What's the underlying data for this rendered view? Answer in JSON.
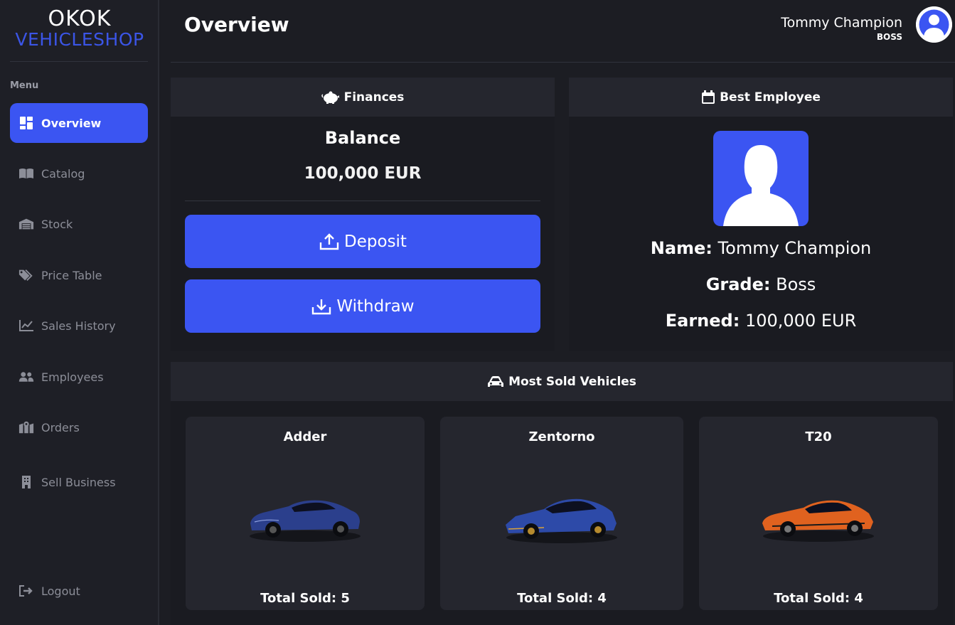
{
  "brand": {
    "top": "OKOK",
    "bottom": "VEHICLESHOP",
    "accent_color": "#3b55f2"
  },
  "sidebar": {
    "heading": "Menu",
    "items": [
      {
        "label": "Overview",
        "icon": "dashboard-icon",
        "active": true
      },
      {
        "label": "Catalog",
        "icon": "book-icon"
      },
      {
        "label": "Stock",
        "icon": "warehouse-icon"
      },
      {
        "label": "Price Table",
        "icon": "tags-icon"
      },
      {
        "label": "Sales History",
        "icon": "chart-line-icon"
      },
      {
        "label": "Employees",
        "icon": "users-icon"
      },
      {
        "label": "Orders",
        "icon": "map-icon"
      },
      {
        "label": "Sell Business",
        "icon": "building-icon"
      }
    ],
    "logout": {
      "label": "Logout",
      "icon": "logout-icon"
    }
  },
  "header": {
    "title": "Overview",
    "user_name": "Tommy Champion",
    "user_role": "BOSS"
  },
  "finances": {
    "heading": "Finances",
    "icon": "piggy-bank-icon",
    "balance_label": "Balance",
    "balance_value": "100,000 EUR",
    "deposit_label": "Deposit",
    "withdraw_label": "Withdraw"
  },
  "best_employee": {
    "heading": "Best Employee",
    "icon": "calendar-icon",
    "name_label": "Name:",
    "name_value": "Tommy Champion",
    "grade_label": "Grade:",
    "grade_value": "Boss",
    "earned_label": "Earned:",
    "earned_value": "100,000 EUR"
  },
  "most_sold": {
    "heading": "Most Sold Vehicles",
    "icon": "car-icon",
    "vehicles": [
      {
        "name": "Adder",
        "sold": "Total Sold: 5",
        "color": "#2b3f8c"
      },
      {
        "name": "Zentorno",
        "sold": "Total Sold: 4",
        "color": "#2d4aa8"
      },
      {
        "name": "T20",
        "sold": "Total Sold: 4",
        "color": "#e0621f"
      }
    ]
  }
}
